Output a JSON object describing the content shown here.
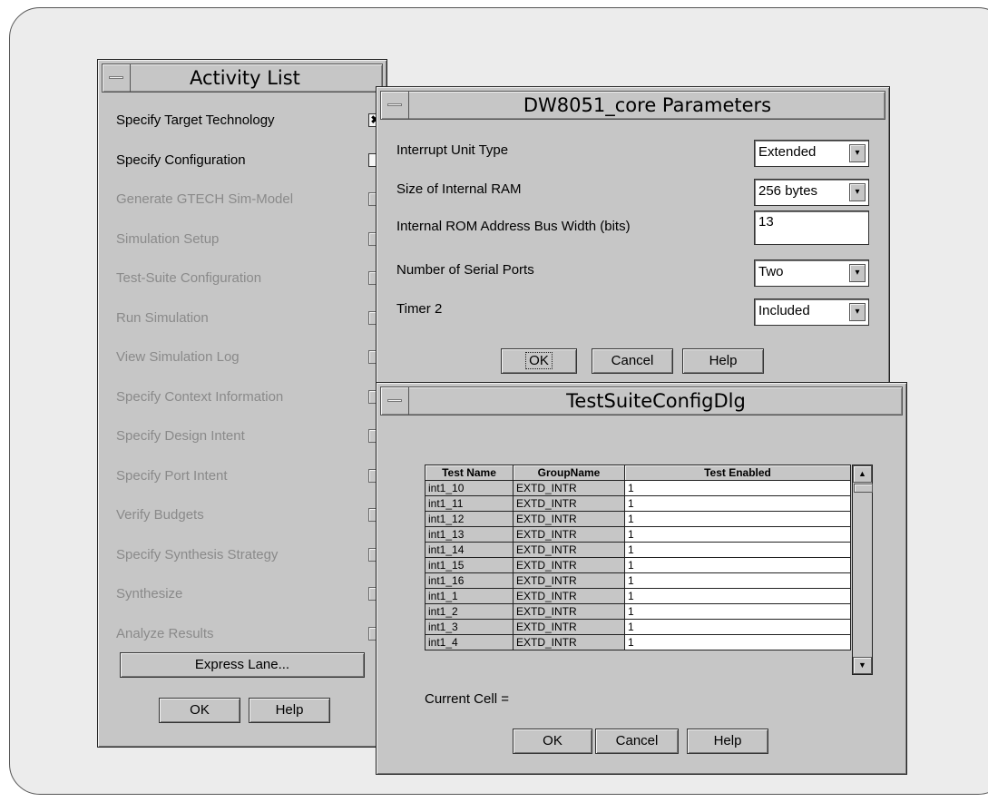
{
  "activity_list": {
    "title": "Activity List",
    "items": [
      {
        "label": "Specify Target Technology",
        "checked": true,
        "enabled": true
      },
      {
        "label": "Specify Configuration",
        "checked": false,
        "enabled": true
      },
      {
        "label": "Generate GTECH Sim-Model",
        "checked": false,
        "enabled": false
      },
      {
        "label": "Simulation Setup",
        "checked": false,
        "enabled": false
      },
      {
        "label": "Test-Suite Configuration",
        "checked": false,
        "enabled": false
      },
      {
        "label": "Run Simulation",
        "checked": false,
        "enabled": false
      },
      {
        "label": "View Simulation Log",
        "checked": false,
        "enabled": false
      },
      {
        "label": "Specify Context Information",
        "checked": false,
        "enabled": false
      },
      {
        "label": "Specify Design Intent",
        "checked": false,
        "enabled": false
      },
      {
        "label": "Specify Port Intent",
        "checked": false,
        "enabled": false
      },
      {
        "label": "Verify Budgets",
        "checked": false,
        "enabled": false
      },
      {
        "label": "Specify Synthesis Strategy",
        "checked": false,
        "enabled": false
      },
      {
        "label": "Synthesize",
        "checked": false,
        "enabled": false
      },
      {
        "label": "Analyze Results",
        "checked": false,
        "enabled": false
      }
    ],
    "express_lane_label": "Express Lane...",
    "ok_label": "OK",
    "help_label": "Help"
  },
  "params": {
    "title": "DW8051_core Parameters",
    "fields": [
      {
        "label": "Interrupt Unit Type",
        "value": "Extended",
        "kind": "combo"
      },
      {
        "label": "Size of Internal RAM",
        "value": "256 bytes",
        "kind": "combo"
      },
      {
        "label": "Internal ROM Address Bus Width (bits)",
        "value": "13",
        "kind": "text"
      },
      {
        "label": "Number of Serial Ports",
        "value": "Two",
        "kind": "combo"
      },
      {
        "label": "Timer 2",
        "value": "Included",
        "kind": "combo"
      }
    ],
    "ok_label": "OK",
    "cancel_label": "Cancel",
    "help_label": "Help"
  },
  "testsuite": {
    "title": "TestSuiteConfigDlg",
    "columns": [
      "Test Name",
      "GroupName",
      "Test Enabled"
    ],
    "rows": [
      [
        "int1_10",
        "EXTD_INTR",
        "1"
      ],
      [
        "int1_11",
        "EXTD_INTR",
        "1"
      ],
      [
        "int1_12",
        "EXTD_INTR",
        "1"
      ],
      [
        "int1_13",
        "EXTD_INTR",
        "1"
      ],
      [
        "int1_14",
        "EXTD_INTR",
        "1"
      ],
      [
        "int1_15",
        "EXTD_INTR",
        "1"
      ],
      [
        "int1_16",
        "EXTD_INTR",
        "1"
      ],
      [
        "int1_1",
        "EXTD_INTR",
        "1"
      ],
      [
        "int1_2",
        "EXTD_INTR",
        "1"
      ],
      [
        "int1_3",
        "EXTD_INTR",
        "1"
      ],
      [
        "int1_4",
        "EXTD_INTR",
        "1"
      ]
    ],
    "current_cell_label": "Current Cell =",
    "ok_label": "OK",
    "cancel_label": "Cancel",
    "help_label": "Help"
  },
  "icons": {
    "window_menu": "window-menu-icon",
    "checked_mark": "✖",
    "scroll_up": "▲",
    "scroll_down": "▼",
    "combo_arrow": "▾"
  }
}
